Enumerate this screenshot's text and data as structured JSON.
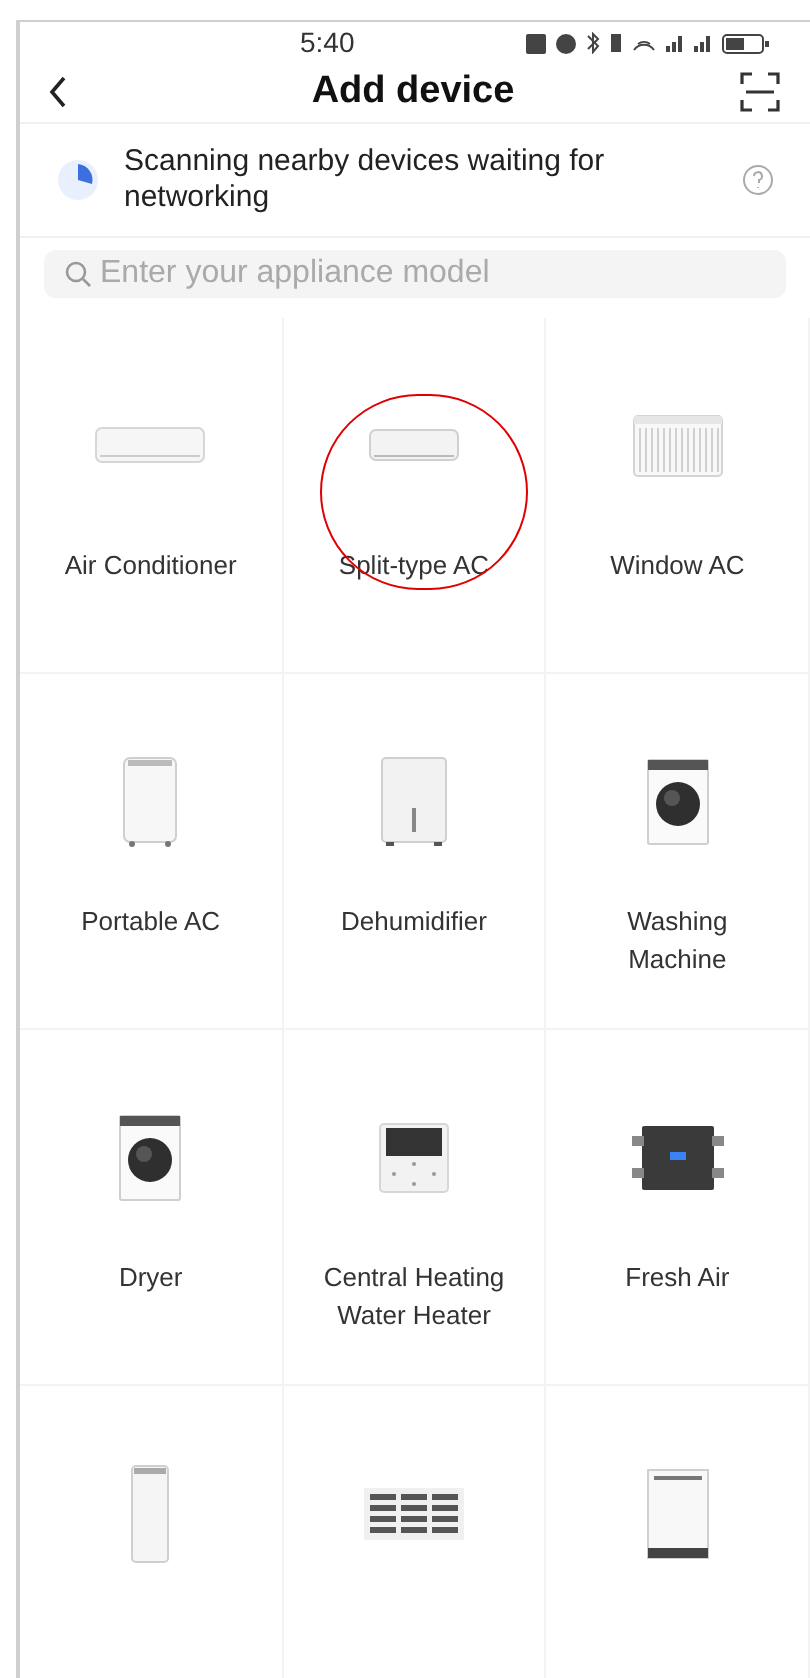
{
  "status_bar": {
    "time": "5:40"
  },
  "header": {
    "title": "Add device"
  },
  "scan_banner": {
    "text": "Scanning nearby devices waiting for networking"
  },
  "search": {
    "placeholder": "Enter your appliance model"
  },
  "devices": [
    {
      "kind": "wall-ac",
      "label": "Air Conditioner",
      "circled": false
    },
    {
      "kind": "split-ac",
      "label": "Split-type AC",
      "circled": true
    },
    {
      "kind": "window-ac",
      "label": "Window AC",
      "circled": false
    },
    {
      "kind": "portable-ac",
      "label": "Portable AC",
      "circled": false
    },
    {
      "kind": "dehumidifier",
      "label": "Dehumidifier",
      "circled": false
    },
    {
      "kind": "washer",
      "label": "Washing Machine",
      "circled": false
    },
    {
      "kind": "dryer",
      "label": "Dryer",
      "circled": false
    },
    {
      "kind": "controller",
      "label": "Central Heating Water Heater",
      "circled": false
    },
    {
      "kind": "fresh-air",
      "label": "Fresh Air",
      "circled": false
    },
    {
      "kind": "tower",
      "circled": false
    },
    {
      "kind": "grille",
      "circled": false
    },
    {
      "kind": "dishwasher",
      "circled": false
    }
  ]
}
